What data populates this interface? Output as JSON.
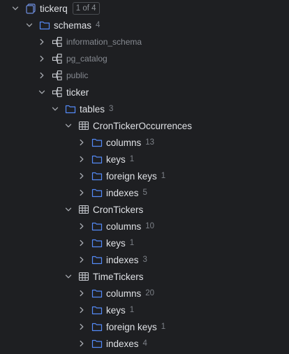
{
  "tree": {
    "root": {
      "label": "tickerq",
      "badge": "1 of 4"
    },
    "schemas": {
      "label": "schemas",
      "count": "4"
    },
    "schema_items": [
      {
        "label": "information_schema"
      },
      {
        "label": "pg_catalog"
      },
      {
        "label": "public"
      },
      {
        "label": "ticker"
      }
    ],
    "tables": {
      "label": "tables",
      "count": "3"
    },
    "table1": {
      "label": "CronTickerOccurrences",
      "children": [
        {
          "label": "columns",
          "count": "13"
        },
        {
          "label": "keys",
          "count": "1"
        },
        {
          "label": "foreign keys",
          "count": "1"
        },
        {
          "label": "indexes",
          "count": "5"
        }
      ]
    },
    "table2": {
      "label": "CronTickers",
      "children": [
        {
          "label": "columns",
          "count": "10"
        },
        {
          "label": "keys",
          "count": "1"
        },
        {
          "label": "indexes",
          "count": "3"
        }
      ]
    },
    "table3": {
      "label": "TimeTickers",
      "children": [
        {
          "label": "columns",
          "count": "20"
        },
        {
          "label": "keys",
          "count": "1"
        },
        {
          "label": "foreign keys",
          "count": "1"
        },
        {
          "label": "indexes",
          "count": "4"
        }
      ]
    }
  },
  "colors": {
    "background": "#1e1f22",
    "text": "#dfe1e5",
    "dim_text": "#868a91",
    "count_text": "#7d8188",
    "folder_icon": "#548af7",
    "db_icon": "#6f8fe0",
    "chevron": "#a7aab0"
  },
  "icons": {
    "expanded": "chevron-down-icon",
    "collapsed": "chevron-right-icon",
    "database": "database-icon",
    "folder": "folder-icon",
    "schema": "schema-icon",
    "table": "table-icon"
  }
}
